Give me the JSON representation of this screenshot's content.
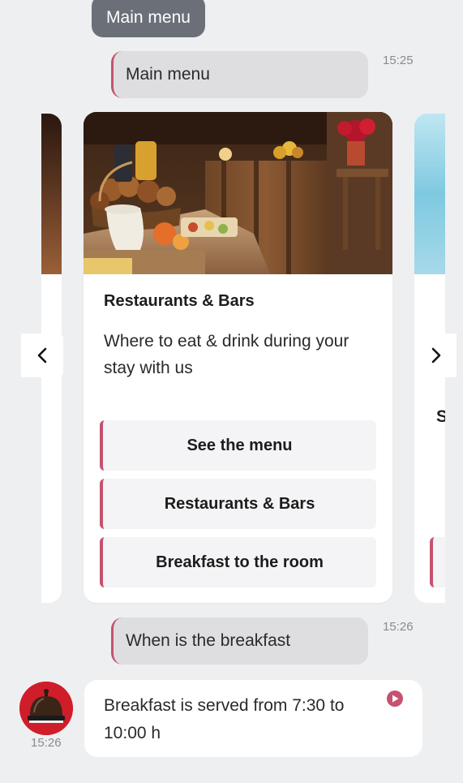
{
  "header": {
    "pill_label": "Main menu"
  },
  "messages": {
    "user_1": {
      "text": "Main menu",
      "time": "15:25"
    },
    "user_2": {
      "text": "When is the breakfast",
      "time": "15:26"
    },
    "bot_1": {
      "text": "Breakfast is served from 7:30 to 10:00 h",
      "time": "15:26"
    }
  },
  "carousel": {
    "current_card": {
      "title": "Restaurants & Bars",
      "description": "Where to eat & drink during your stay with us",
      "buttons": [
        "See the menu",
        "Restaurants & Bars",
        "Breakfast to the room"
      ]
    },
    "next_card": {
      "title_partial": "S"
    },
    "prev_arrow_icon": "chevron-left-icon",
    "next_arrow_icon": "chevron-right-icon"
  },
  "colors": {
    "accent": "#c5526f",
    "background": "#eeeff1",
    "pill_dark": "#6b7078",
    "user_bubble": "#dedee0",
    "card": "#ffffff",
    "button_bg": "#f4f4f6",
    "avatar_red": "#d11f2a"
  }
}
